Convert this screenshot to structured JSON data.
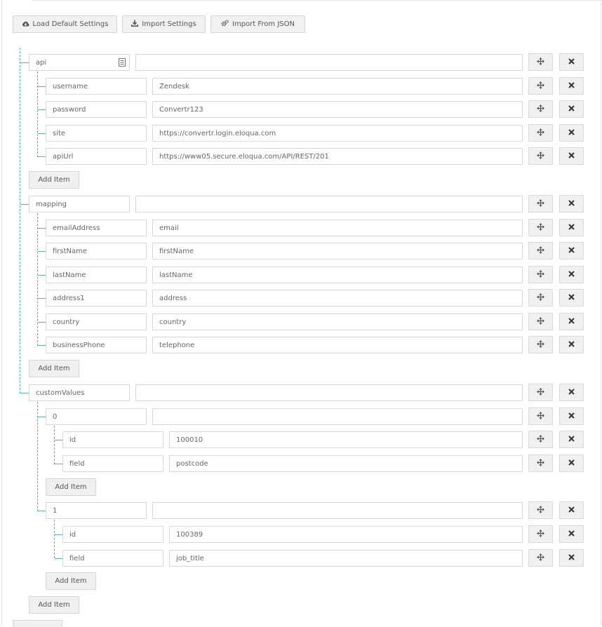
{
  "toolbar": {
    "load_default_label": "Load Default Settings",
    "import_settings_label": "Import Settings",
    "import_json_label": "Import From JSON"
  },
  "tree": {
    "api": {
      "key": "api",
      "value": "",
      "children": [
        {
          "key": "username",
          "value": "Zendesk"
        },
        {
          "key": "password",
          "value": "Convertr123"
        },
        {
          "key": "site",
          "value": "https://convertr.login.eloqua.com"
        },
        {
          "key": "apiUrl",
          "value": "https://www05.secure.eloqua.com/API/REST/201"
        }
      ]
    },
    "mapping": {
      "key": "mapping",
      "value": "",
      "children": [
        {
          "key": "emailAddress",
          "value": "email"
        },
        {
          "key": "firstName",
          "value": "firstName"
        },
        {
          "key": "lastName",
          "value": "lastName"
        },
        {
          "key": "address1",
          "value": "address"
        },
        {
          "key": "country",
          "value": "country"
        },
        {
          "key": "businessPhone",
          "value": "telephone"
        }
      ]
    },
    "customValues": {
      "key": "customValues",
      "value": "",
      "children": [
        {
          "key": "0",
          "value": "",
          "children": [
            {
              "key": "id",
              "value": "100010"
            },
            {
              "key": "field",
              "value": "postcode"
            }
          ]
        },
        {
          "key": "1",
          "value": "",
          "children": [
            {
              "key": "id",
              "value": "100389"
            },
            {
              "key": "field",
              "value": "job_title"
            }
          ]
        }
      ]
    }
  },
  "add_item_label": "Add Item",
  "icons": {
    "load": "cloud-download-icon",
    "import": "download-icon",
    "json": "cogs-icon",
    "edit": "edit-icon",
    "move": "move-icon",
    "remove": "close-icon"
  },
  "colors": {
    "tree_line": "#54a9c9",
    "button_bg": "#f0f0f0",
    "border": "#d7d7d7"
  }
}
